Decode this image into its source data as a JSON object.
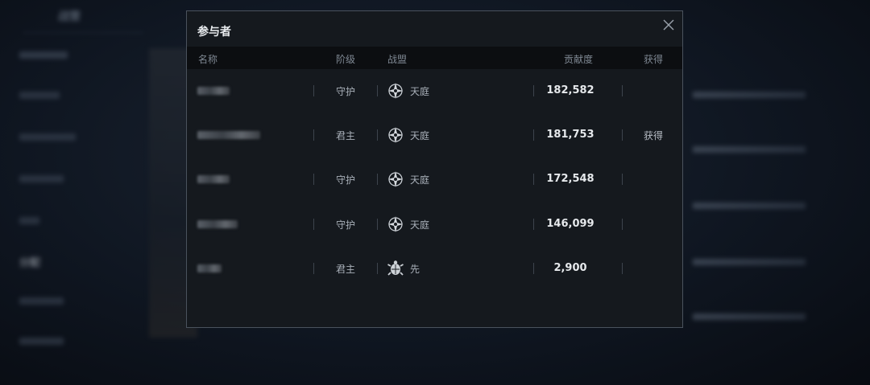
{
  "background": {
    "tab_label": "战营",
    "sidebar_active": "分配"
  },
  "modal": {
    "title": "参与者",
    "columns": {
      "name": "名称",
      "rank": "阶级",
      "alliance": "战盟",
      "contribution": "贡献度",
      "obtained": "获得"
    },
    "rows": [
      {
        "rank": "守护",
        "alliance": "天庭",
        "emblem": "star-compass-emblem",
        "contribution": "182,582",
        "obtained": ""
      },
      {
        "rank": "君主",
        "alliance": "天庭",
        "emblem": "star-compass-emblem",
        "contribution": "181,753",
        "obtained": "获得"
      },
      {
        "rank": "守护",
        "alliance": "天庭",
        "emblem": "star-compass-emblem",
        "contribution": "172,548",
        "obtained": ""
      },
      {
        "rank": "守护",
        "alliance": "天庭",
        "emblem": "star-compass-emblem",
        "contribution": "146,099",
        "obtained": ""
      },
      {
        "rank": "君主",
        "alliance": "先",
        "emblem": "turtle-emblem",
        "contribution": "2,900",
        "obtained": ""
      }
    ]
  },
  "colors": {
    "modal_bg": "#15191e",
    "header_row_bg": "#0c0e11",
    "border": "#4a525d"
  }
}
